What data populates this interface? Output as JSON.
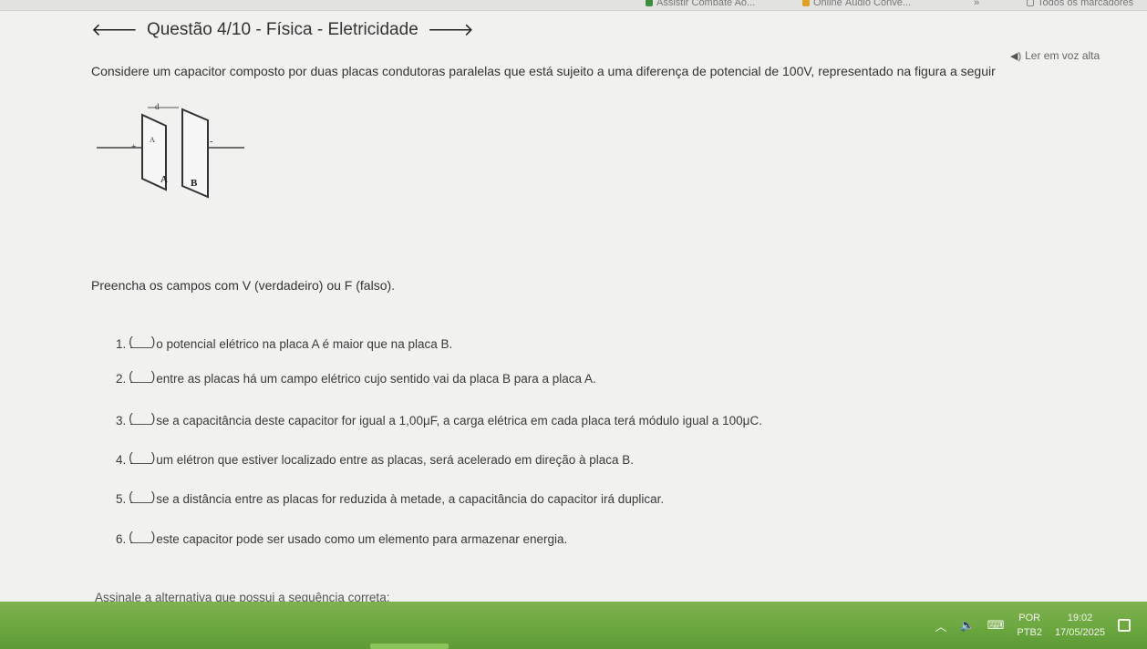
{
  "bookmarks": [
    {
      "label": "Assistir Combate Ao...",
      "icon_color": "#3a8f3a"
    },
    {
      "label": "Online Áudio Conve...",
      "icon_color": "#e0a020"
    },
    {
      "label": "»",
      "icon_color": ""
    },
    {
      "label": "Todos os marcadores",
      "icon_color": ""
    }
  ],
  "header": {
    "title": "Questão 4/10 - Física - Eletricidade",
    "back_icon": "arrow-left-icon",
    "next_icon": "arrow-right-icon"
  },
  "read_aloud": {
    "label": "Ler em voz alta",
    "icon": "speaker-icon"
  },
  "prompt": "Considere um capacitor composto por duas placas condutoras paralelas que está sujeito a uma diferença de potencial de 100V, representado na figura a seguir",
  "figure": {
    "labels": {
      "d": "d",
      "plus": "+",
      "minus": "-",
      "plate_a": "A",
      "plate_b": "B",
      "field": "A"
    }
  },
  "instructions": "Preencha os campos com V (verdadeiro) ou F (falso).",
  "items": [
    {
      "num": "1.",
      "text": "o potencial elétrico na placa A é maior que na placa B."
    },
    {
      "num": "2.",
      "text": "entre as placas há um campo elétrico cujo sentido vai da placa B para a placa A."
    },
    {
      "num": "3.",
      "text": "se a capacitância deste capacitor for igual a 1,00μF, a carga elétrica em cada placa terá módulo igual a 100μC."
    },
    {
      "num": "4.",
      "text": "um elétron que estiver localizado entre as placas, será acelerado em direção à placa B."
    },
    {
      "num": "5.",
      "text": "se a distância entre as placas for reduzida à metade, a capacitância do capacitor irá duplicar."
    },
    {
      "num": "6.",
      "text": "este capacitor pode ser usado como um elemento para armazenar energia."
    }
  ],
  "footer_prompt": "Assinale a alternativa que possui a sequência correta:",
  "taskbar": {
    "lang_top": "POR",
    "lang_bottom": "PTB2",
    "time": "19:02",
    "date": "17/05/2025",
    "accent_color": "#6aa63e"
  }
}
